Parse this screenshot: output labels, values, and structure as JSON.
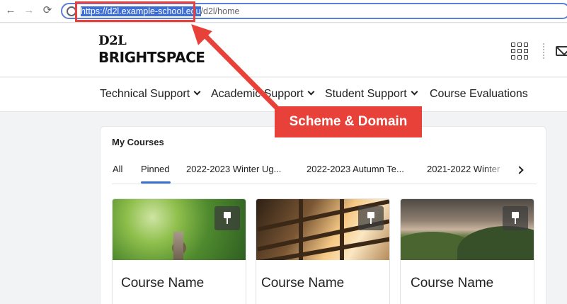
{
  "browser": {
    "back_icon": "←",
    "forward_icon": "→",
    "reload_icon": "⟳",
    "url_highlighted": "https://d2l.example-school.edu",
    "url_rest": "/d2l/home"
  },
  "header": {
    "logo_top": "D2L",
    "logo_bottom": "BRIGHTSPACE"
  },
  "nav": {
    "items": [
      {
        "label": "Technical Support",
        "has_dropdown": true
      },
      {
        "label": "Academic Support",
        "has_dropdown": true
      },
      {
        "label": "Student Support",
        "has_dropdown": true
      },
      {
        "label": "Course Evaluations",
        "has_dropdown": false
      }
    ]
  },
  "courses": {
    "title": "My Courses",
    "tabs": [
      {
        "label": "All",
        "active": false
      },
      {
        "label": "Pinned",
        "active": true
      },
      {
        "label": "2022-2023 Winter Ug...",
        "active": false
      },
      {
        "label": "2022-2023 Autumn Te...",
        "active": false
      },
      {
        "label": "2021-2022 Winter",
        "active": false
      }
    ],
    "tiles": [
      {
        "name": "Course Name",
        "image": "tree-canopy",
        "pinned": true
      },
      {
        "name": "Course Name",
        "image": "sunlit-beams",
        "pinned": true
      },
      {
        "name": "Course Name",
        "image": "mountain-valley",
        "pinned": true
      }
    ]
  },
  "annotation": {
    "label": "Scheme & Domain",
    "color": "#e8413a"
  },
  "colors": {
    "accent": "#3b6fc9",
    "url_highlight": "#3d6ed6",
    "page_background": "#f1f3f5"
  }
}
